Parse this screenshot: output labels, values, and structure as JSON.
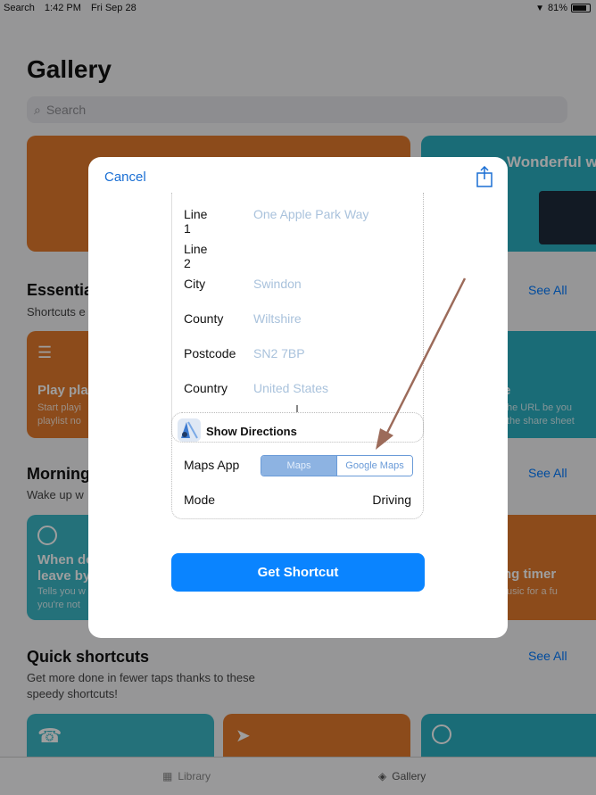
{
  "status_bar": {
    "back_app": "Search",
    "time": "1:42 PM",
    "date": "Fri Sep 28",
    "battery": "81%"
  },
  "gallery": {
    "title": "Gallery",
    "search_placeholder": "Search",
    "featured_right_title": "Wonderful w",
    "sections": {
      "essentials": {
        "title": "Essentia",
        "subtitle": "Shortcuts e",
        "see_all": "See All",
        "card_left_title": "Play play",
        "card_left_sub": "Start playi",
        "card_left_sub2": "playlist no",
        "card_right_title": "e",
        "card_right_sub": "he URL be you",
        "card_right_sub2": "the share sheet"
      },
      "morning": {
        "title": "Morning",
        "subtitle": "Wake up w",
        "see_all": "See All",
        "card_left_title": "When do",
        "card_left_title2": "leave by",
        "card_left_sub": "Tells you w",
        "card_left_sub2": "you're not",
        "card_right_title": "ng timer",
        "card_right_sub": "usic for a fu"
      },
      "quick": {
        "title": "Quick shortcuts",
        "subtitle": "Get more done in fewer taps thanks to these",
        "subtitle2": "speedy shortcuts!",
        "see_all": "See All"
      }
    }
  },
  "tabbar": {
    "library": "Library",
    "gallery": "Gallery"
  },
  "modal": {
    "cancel_label": "Cancel",
    "address_fields": [
      {
        "label": "Line 1",
        "value": "One Apple Park Way"
      },
      {
        "label": "Line 2",
        "value": ""
      },
      {
        "label": "City",
        "value": "Swindon"
      },
      {
        "label": "County",
        "value": "Wiltshire"
      },
      {
        "label": "Postcode",
        "value": "SN2 7BP"
      },
      {
        "label": "Country",
        "value": "United States"
      }
    ],
    "directions": {
      "title": "Show Directions",
      "maps_app_label": "Maps App",
      "maps_options": [
        "Maps",
        "Google Maps"
      ],
      "maps_selected": "Maps",
      "mode_label": "Mode",
      "mode_value": "Driving"
    },
    "get_shortcut_label": "Get Shortcut"
  },
  "colors": {
    "accent": "#0a84ff",
    "orange_card": "#e27a2c",
    "teal_card": "#2aaec0",
    "annotation_arrow": "#9c6b5a"
  }
}
